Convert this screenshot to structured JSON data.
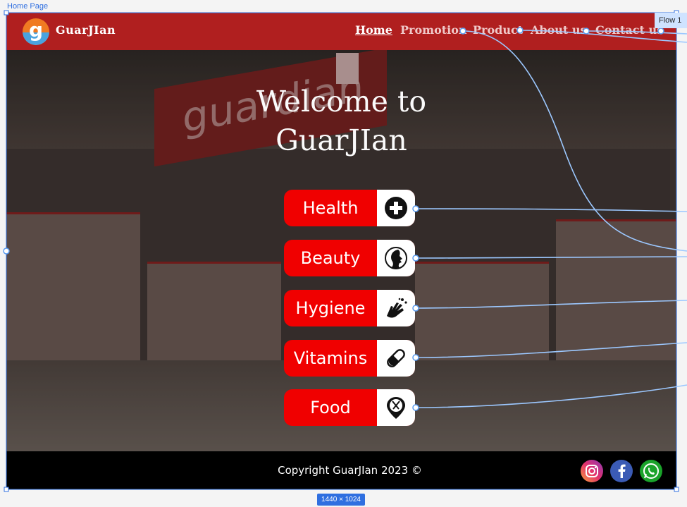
{
  "canvas": {
    "frame_label": "Home Page",
    "flow_label": "Flow 1",
    "size_label": "1440 × 1024"
  },
  "navbar": {
    "brand": "GuarJIan",
    "logo_letter": "g",
    "links": [
      "Home",
      "Promotion",
      "Product",
      "About us",
      "Contact us"
    ],
    "active": "Home"
  },
  "hero": {
    "title_line1": "Welcome to",
    "title_line2": "GuarJIan",
    "background_sign_text": "guardian"
  },
  "categories": [
    {
      "label": "Health",
      "icon": "plus-circle-icon"
    },
    {
      "label": "Beauty",
      "icon": "face-profile-icon"
    },
    {
      "label": "Hygiene",
      "icon": "hand-wash-icon"
    },
    {
      "label": "Vitamins",
      "icon": "pill-icon"
    },
    {
      "label": "Food",
      "icon": "fork-knife-pin-icon"
    }
  ],
  "footer": {
    "copyright": "Copyright GuarJIan 2023 ©",
    "social": [
      "instagram-icon",
      "facebook-icon",
      "whatsapp-icon"
    ]
  },
  "colors": {
    "navbar": "#b01f1f",
    "button": "#f00000",
    "footer": "#000000",
    "selection": "#2f6fe0"
  }
}
